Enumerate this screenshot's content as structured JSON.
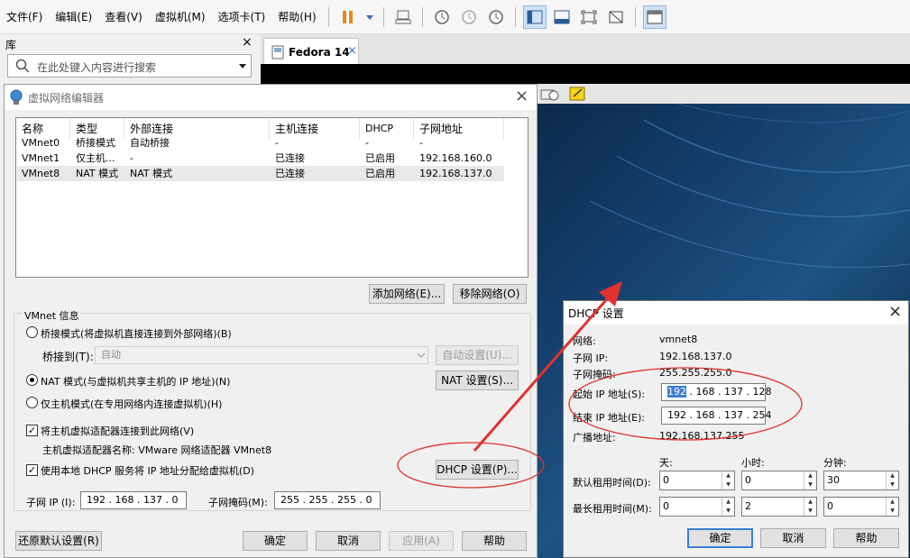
{
  "menubar": {
    "items": [
      "文件(F)",
      "编辑(E)",
      "查看(V)",
      "虚拟机(M)",
      "选项卡(T)",
      "帮助(H)"
    ]
  },
  "library": {
    "title": "库",
    "close": "×",
    "search_placeholder": "在此处键入内容进行搜索"
  },
  "tab": {
    "label": "Fedora 14",
    "close": "×"
  },
  "vne": {
    "title": "虚拟网络编辑器",
    "close": "×",
    "columns": [
      "名称",
      "类型",
      "外部连接",
      "主机连接",
      "DHCP",
      "子网地址"
    ],
    "rows": [
      [
        "VMnet0",
        "桥接模式",
        "自动桥接",
        "-",
        "-",
        "-"
      ],
      [
        "VMnet1",
        "仅主机...",
        "-",
        "已连接",
        "已启用",
        "192.168.160.0"
      ],
      [
        "VMnet8",
        "NAT 模式",
        "NAT 模式",
        "已连接",
        "已启用",
        "192.168.137.0"
      ]
    ],
    "add_network": "添加网络(E)...",
    "remove_network": "移除网络(O)",
    "vmnet_info": "VMnet 信息",
    "bridge_mode": "桥接模式(将虚拟机直接连接到外部网络)(B)",
    "bridge_to_label": "桥接到(T):",
    "bridge_to_value": "自动",
    "auto_settings": "自动设置(U)...",
    "nat_mode": "NAT 模式(与虚拟机共享主机的 IP 地址)(N)",
    "nat_settings": "NAT 设置(S)...",
    "host_only": "仅主机模式(在专用网络内连接虚拟机)(H)",
    "connect_adapter": "将主机虚拟适配器连接到此网络(V)",
    "adapter_name": "主机虚拟适配器名称: VMware 网络适配器 VMnet8",
    "use_dhcp": "使用本地 DHCP 服务将 IP 地址分配给虚拟机(D)",
    "dhcp_settings": "DHCP 设置(P)...",
    "subnet_ip_label": "子网 IP (I):",
    "subnet_ip_value": "192 . 168 . 137 . 0",
    "subnet_mask_label": "子网掩码(M):",
    "subnet_mask_value": "255 . 255 . 255 . 0",
    "restore_defaults": "还原默认设置(R)",
    "ok": "确定",
    "cancel": "取消",
    "apply": "应用(A)",
    "help": "帮助"
  },
  "dhcp": {
    "title": "DHCP 设置",
    "close": "×",
    "network_label": "网络:",
    "network_value": "vmnet8",
    "subnet_ip_label": "子网 IP:",
    "subnet_ip_value": "192.168.137.0",
    "subnet_mask_label": "子网掩码:",
    "subnet_mask_value": "255.255.255.0",
    "start_ip_label": "起始 IP 地址(S):",
    "start_ip_highlight": "192",
    "start_ip_rest": " . 168 . 137 . 128",
    "end_ip_label": "结束 IP 地址(E):",
    "end_ip_value": "192 . 168 . 137 . 254",
    "broadcast_label": "广播地址:",
    "broadcast_value": "192.168.137.255",
    "days": "天:",
    "hours": "小时:",
    "minutes": "分钟:",
    "default_lease_label": "默认租用时间(D):",
    "default_lease": [
      "0",
      "0",
      "30"
    ],
    "max_lease_label": "最长租用时间(M):",
    "max_lease": [
      "0",
      "2",
      "0"
    ],
    "ok": "确定",
    "cancel": "取消",
    "help": "帮助"
  },
  "colors": {
    "annotation": "#e0322e",
    "selection": "#3a7fd0"
  }
}
